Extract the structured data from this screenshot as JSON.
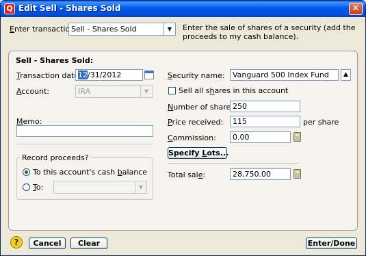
{
  "window": {
    "title": "Edit Sell - Shares Sold",
    "app_icon_glyph": "Q",
    "close_glyph": "✕"
  },
  "transaction": {
    "label_pre": "E",
    "label_rest": "nter transaction:",
    "value": "Sell - Shares Sold",
    "description": "Enter the sale of shares of a security (add the proceeds to my cash balance)."
  },
  "panel": {
    "heading": "Sell - Shares Sold:",
    "date_label_pre": "",
    "date_label_u": "T",
    "date_label_rest": "ransaction date:",
    "date_selected": "12",
    "date_rest": "/31/2012",
    "account_label_u": "A",
    "account_label_rest": "ccount:",
    "account_value": "IRA",
    "memo_label_u": "M",
    "memo_label_rest": "emo:",
    "memo_value": "",
    "record_proceeds": "Record proceeds?",
    "radio_cash_pre": "To this account's cash ",
    "radio_cash_u": "b",
    "radio_cash_rest": "alance",
    "radio_to_u": "T",
    "radio_to_rest": "o:",
    "to_account_value": "",
    "security_label_u": "S",
    "security_label_rest": "ecurity name:",
    "security_value": "Vanguard 500 Index Fund",
    "sell_all_pre": "Sell all s",
    "sell_all_u": "h",
    "sell_all_rest": "ares in this account",
    "shares_label_u": "N",
    "shares_label_rest": "umber of shares:",
    "shares_value": "250",
    "price_label_u": "P",
    "price_label_rest": "rice received:",
    "price_value": "115",
    "price_unit": "per share",
    "commission_label_u": "C",
    "commission_label_rest": "ommission:",
    "commission_value": "0.00",
    "specify_lots_pre": "Specify ",
    "specify_lots_u": "L",
    "specify_lots_rest": "ots...",
    "total_label_pre": "Total sal",
    "total_label_u": "e",
    "total_label_rest": ":",
    "total_value": "28,750.00"
  },
  "footer": {
    "help_glyph": "?",
    "cancel_label": "Cancel",
    "clear_label": "Clear",
    "enter_done_label": "Enter/Done"
  },
  "colors": {
    "titlebar": "#0058ee",
    "selection": "#316ac5",
    "button_border": "#003c74"
  }
}
